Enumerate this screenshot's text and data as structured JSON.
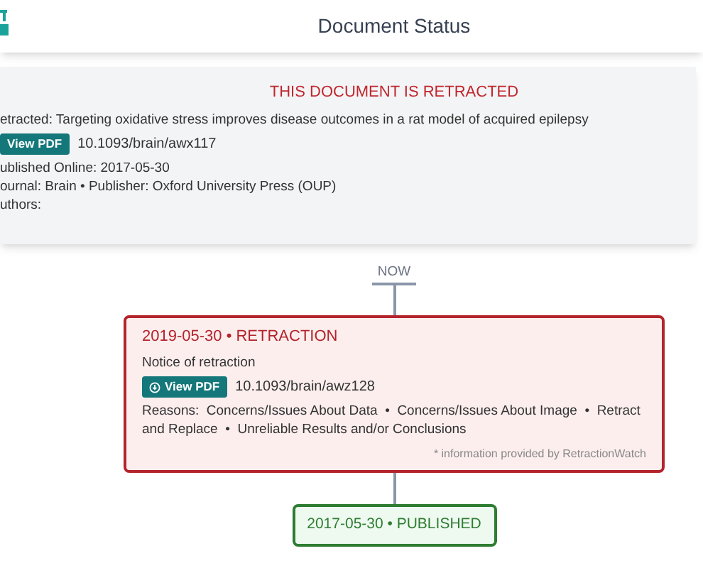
{
  "header": {
    "title": "Document Status"
  },
  "document": {
    "banner": "THIS DOCUMENT IS RETRACTED",
    "title": "etracted: Targeting oxidative stress improves disease outcomes in a rat model of acquired epilepsy",
    "pdf_button": "View PDF",
    "doi": "10.1093/brain/awx117",
    "published": "ublished Online: 2017-05-30",
    "journal": "ournal: Brain • Publisher: Oxford University Press (OUP)",
    "authors": "uthors:"
  },
  "timeline": {
    "now_label": "NOW",
    "events": [
      {
        "kind": "retraction",
        "heading": "2019-05-30 • RETRACTION",
        "notice": "Notice of retraction",
        "pdf_button": "View PDF",
        "doi": "10.1093/brain/awz128",
        "reasons": "Reasons:  Concerns/Issues About Data  •  Concerns/Issues About Image  •  Retract and Replace  •  Unreliable Results and/or Conclusions",
        "source": "* information provided by RetractionWatch"
      },
      {
        "kind": "published",
        "heading": "2017-05-30 • PUBLISHED"
      }
    ]
  }
}
